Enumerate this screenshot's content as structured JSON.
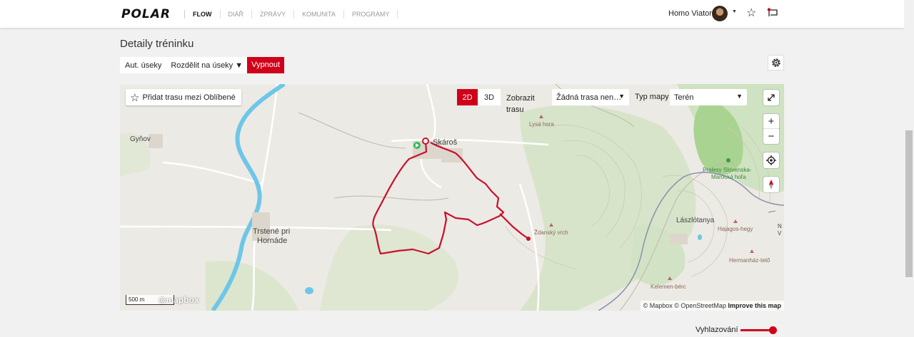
{
  "header": {
    "logo": "POLAR",
    "nav": [
      "FLOW",
      "DIÁŘ",
      "ZPRÁVY",
      "KOMUNITA",
      "PROGRAMY"
    ],
    "user_name": "Homo Viator"
  },
  "page": {
    "title": "Detaily tréninku"
  },
  "segments": {
    "label": "Aut. úseky",
    "select_value": "Rozdělit na úseky",
    "button": "Vypnout"
  },
  "map": {
    "favorite_button": "Přidat trasu mezi Oblíbené",
    "view_2d": "2D",
    "view_3d": "3D",
    "show_route_label": "Zobrazit trasu",
    "route_select": "Žádná trasa nen…",
    "map_type_label": "Typ mapy",
    "map_type_value": "Terén",
    "zoom_in": "+",
    "zoom_out": "−",
    "scale": "500 m",
    "logo": "mapbox",
    "attribution": "© Mapbox © OpenStreetMap",
    "improve": "Improve this map",
    "places": {
      "gynov": "Gyňov",
      "skaros": "Skároš",
      "trstene": "Trstené pri",
      "hornade": "Hornáde",
      "lysa_hora": "Lysá hora",
      "zdansky_vrch": "Ždanský vrch",
      "prales_1": "Pralesy Slovenska-",
      "prales_2": "Marocká hoľa",
      "laszlotanya": "Lászlótanya",
      "hajagos": "Hajagos-hegy",
      "hermanhaz": "Hermanház-tető",
      "kelemen": "Kelemen-bérc",
      "edge_1": "N",
      "edge_2": "V"
    },
    "colors": {
      "route": "#c8102e",
      "river": "#6ec6e8",
      "accent": "#d10019"
    }
  },
  "smoothing": {
    "label": "Vyhlazování"
  }
}
